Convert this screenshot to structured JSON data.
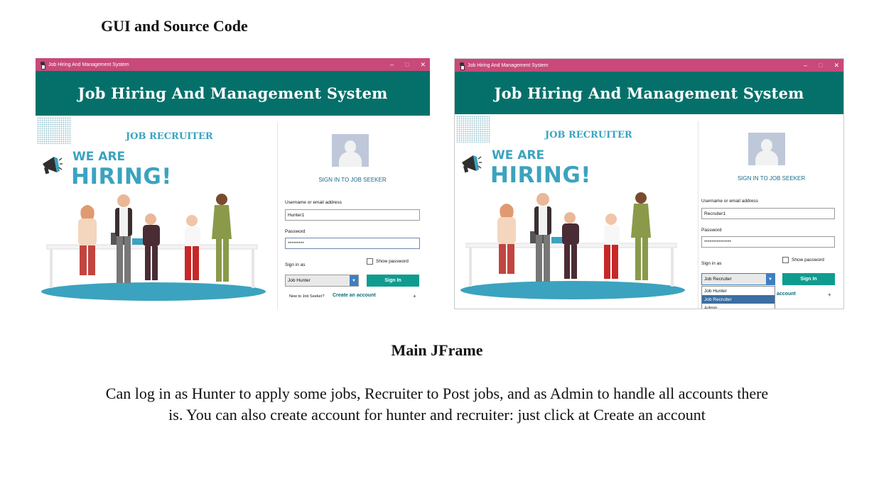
{
  "doc": {
    "heading": "GUI and Source Code",
    "caption": "Main JFrame",
    "description": "Can log in as Hunter to apply some jobs, Recruiter to Post jobs, and as Admin to handle all accounts there is. You can also create account for hunter and recruiter: just click at Create an account"
  },
  "colors": {
    "titlebar": "#c8497a",
    "banner": "#05706a",
    "accent": "#3ba3bf",
    "sign_in_button": "#0f9c8e",
    "link": "#0b6f78",
    "dropdown_selected": "#3b6ea1"
  },
  "window": {
    "title": "Job Hiring And Management System",
    "controls": [
      "–",
      "□",
      "✕"
    ],
    "banner_title": "Job Hiring And Management System"
  },
  "artwork": {
    "recruiter_label": "JOB RECRUITER",
    "we_are": "WE ARE",
    "hiring": "HIRING!"
  },
  "form": {
    "title": "SIGN IN TO JOB SEEKER",
    "username_label": "Username or email address",
    "password_label": "Password",
    "sign_in_as_label": "Sign in as",
    "show_password_label": "Show password",
    "sign_in_button": "Sign In",
    "new_text": "New to Job Seeker?",
    "create_link": "Create an account",
    "plus": "+"
  },
  "screens": [
    {
      "username": "Hunter1",
      "password": "*********",
      "role": "Job Hunter"
    },
    {
      "username": "Recruiter1",
      "password": "***************",
      "role": "Job Recruiter",
      "create_link_partial": "account",
      "dropdown_options": [
        "Job Hunter",
        "Job Recruiter",
        "Admin"
      ],
      "dropdown_selected": "Job Recruiter"
    }
  ]
}
